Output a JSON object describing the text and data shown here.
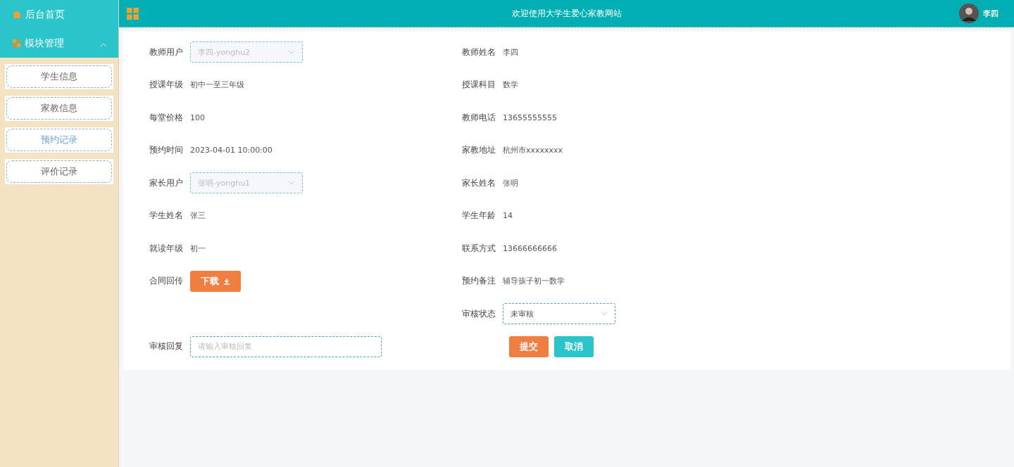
{
  "sidebar": {
    "home": {
      "label": "后台首页"
    },
    "module": {
      "label": "模块管理",
      "expanded": true
    },
    "items": [
      {
        "label": "学生信息",
        "selected": false
      },
      {
        "label": "家教信息",
        "selected": false
      },
      {
        "label": "预约记录",
        "selected": true
      },
      {
        "label": "评价记录",
        "selected": false
      }
    ]
  },
  "header": {
    "title": "欢迎使用大学生爱心家教网站",
    "user": "李四"
  },
  "form": {
    "rows": [
      {
        "left": {
          "kind": "select",
          "label": "教师用户",
          "value": "李四-yonghu2",
          "disabled": true
        },
        "right": {
          "kind": "text",
          "label": "教师姓名",
          "value": "李四"
        }
      },
      {
        "left": {
          "kind": "text",
          "label": "授课年级",
          "value": "初中一至三年级"
        },
        "right": {
          "kind": "text",
          "label": "授课科目",
          "value": "数学"
        }
      },
      {
        "left": {
          "kind": "text",
          "label": "每堂价格",
          "value": "100"
        },
        "right": {
          "kind": "text",
          "label": "教师电话",
          "value": "13655555555"
        }
      },
      {
        "left": {
          "kind": "text",
          "label": "预约时间",
          "value": "2023-04-01 10:00:00"
        },
        "right": {
          "kind": "text",
          "label": "家教地址",
          "value": "杭州市xxxxxxxx"
        }
      },
      {
        "left": {
          "kind": "select",
          "label": "家长用户",
          "value": "张明-yonghu1",
          "disabled": true
        },
        "right": {
          "kind": "text",
          "label": "家长姓名",
          "value": "张明"
        }
      },
      {
        "left": {
          "kind": "text",
          "label": "学生姓名",
          "value": "张三"
        },
        "right": {
          "kind": "text",
          "label": "学生年龄",
          "value": "14"
        }
      },
      {
        "left": {
          "kind": "text",
          "label": "就读年级",
          "value": "初一"
        },
        "right": {
          "kind": "text",
          "label": "联系方式",
          "value": "13666666666"
        }
      },
      {
        "left": {
          "kind": "download",
          "label": "合同回传",
          "button": "下载"
        },
        "right": {
          "kind": "text",
          "label": "预约备注",
          "value": "辅导孩子初一数学"
        }
      },
      {
        "right": {
          "kind": "select",
          "label": "审核状态",
          "value": "未审核",
          "disabled": false
        }
      },
      {
        "left": {
          "kind": "input",
          "label": "审核回复",
          "placeholder": "请输入审核回复"
        },
        "right": {
          "kind": "actions",
          "buttons": [
            {
              "label": "提交",
              "kind": "submit"
            },
            {
              "label": "取消",
              "kind": "cancel"
            }
          ]
        }
      }
    ]
  }
}
